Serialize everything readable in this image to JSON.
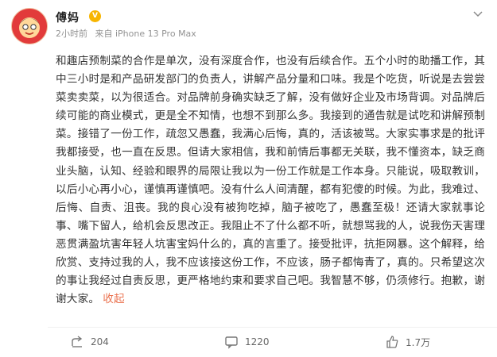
{
  "post": {
    "username": "傅妈",
    "badge": "V",
    "time": "2小时前",
    "source": "来自 iPhone 13 Pro Max",
    "content": "和趣店预制菜的合作是单次，没有深度合作，也没有后续合作。五个小时的助播工作，其中三小时是和产品研发部门的负责人，讲解产品分量和口味。我是个吃货，听说是去尝尝菜卖卖菜，以为很适合。对品牌前身确实缺乏了解，没有做好企业及市场背调。对品牌后续可能的商业模式，更是全不知情，也想不到那么多。我接到的通告就是试吃和讲解预制菜。接错了一份工作，疏忽又愚蠢，我满心后悔，真的，活该被骂。大家实事求是的批评我都接受，也一直在反思。但请大家相信，我和前情后事都无关联，我不懂资本，缺乏商业头脑，认知、经验和眼界的局限让我以为一份工作就是工作本身。只能说，吸取教训，以后小心再小心，谨慎再谨慎吧。没有什么人间清醒，都有犯傻的时候。为此，我难过、后悔、自责、沮丧。我的良心没有被狗吃掉，脑子被吃了，愚蠢至极！还请大家就事论事、嘴下留人，给机会反思改正。我阻止不了什么都不听，就想骂我的人，说我伤天害理恶贯满盈坑害年轻人坑害宝妈什么的，真的言重了。接受批评，抗拒网暴。这个解释，给欣赏、支持过我的人，我不应该接这份工作，不应该，肠子都悔青了，真的。只希望这次的事让我经过自责反思，更严格地约束和要求自己吧。我智慧不够，仍须修行。抱歉，谢谢大家。",
    "collapse_label": "收起"
  },
  "actions": {
    "share_count": "204",
    "comment_count": "1220",
    "like_count": "1.7万"
  },
  "icons": {
    "menu": "chevron-down-icon",
    "share": "share-icon",
    "comment": "comment-icon",
    "like": "thumbs-up-icon"
  },
  "colors": {
    "accent": "#eb7350",
    "badge": "#f7b500",
    "muted": "#939393"
  }
}
